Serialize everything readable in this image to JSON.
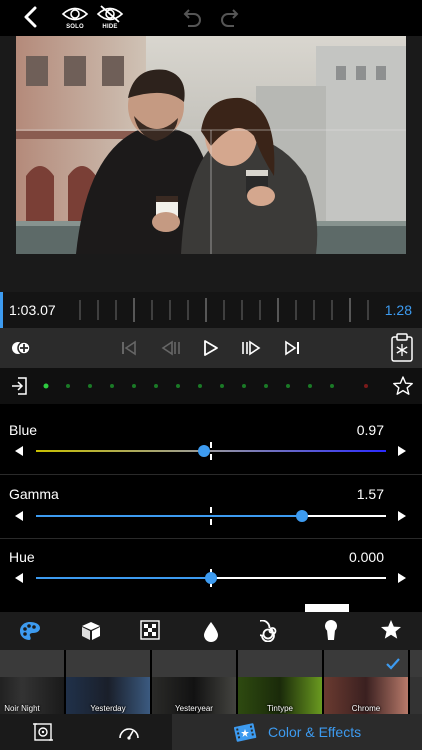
{
  "topbar": {
    "solo_label": "SOLO",
    "hide_label": "HIDE"
  },
  "timeline": {
    "current_time": "1:03.07",
    "duration": "1.28"
  },
  "sliders": [
    {
      "label": "Blue",
      "value": "0.97",
      "position": 0.48
    },
    {
      "label": "Gamma",
      "value": "1.57",
      "position": 0.76
    },
    {
      "label": "Hue",
      "value": "0.000",
      "position": 0.5
    }
  ],
  "categories": [
    "palette-icon",
    "cube-icon",
    "pattern-icon",
    "drop-icon",
    "spiral-icon",
    "keyhole-icon",
    "star-icon"
  ],
  "thumbnails": [
    {
      "label": "Noir Night",
      "selected": false
    },
    {
      "label": "Yesterday",
      "selected": false
    },
    {
      "label": "Yesteryear",
      "selected": false
    },
    {
      "label": "Tintype",
      "selected": false
    },
    {
      "label": "Chrome",
      "selected": true
    }
  ],
  "tabbar": {
    "color_effects_label": "Color & Effects"
  },
  "colors": {
    "accent": "#3d9bf0",
    "blue_track_start": "#c8c000",
    "blue_track_end": "#2a2aff"
  }
}
